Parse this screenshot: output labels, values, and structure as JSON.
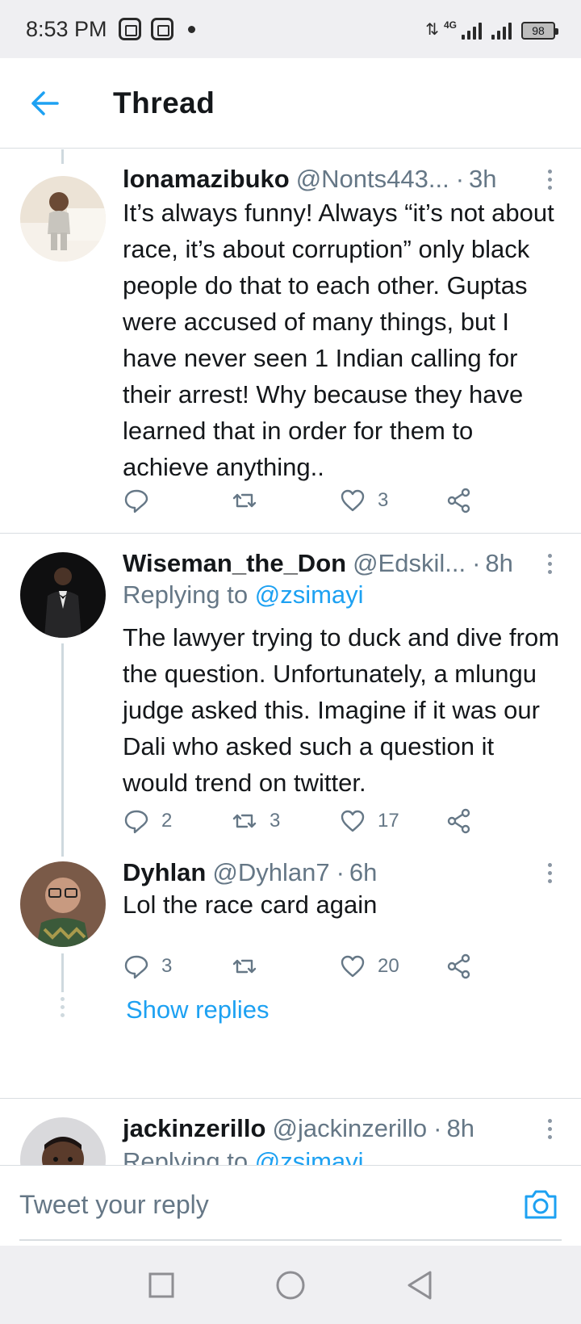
{
  "status_bar": {
    "time": "8:53 PM",
    "network": "4G",
    "battery": "98"
  },
  "header": {
    "title": "Thread",
    "back_icon": "arrow-left-icon"
  },
  "tweets": [
    {
      "name": "lonamazibuko",
      "handle": "@Nonts443...",
      "sep": "·",
      "time": "3h",
      "reply_to_prefix": "",
      "reply_to": "",
      "text": "It’s always funny! Always “it’s not about race, it’s about corruption” only black people do that to each other. Guptas were accused of many things, but I have never seen 1 Indian calling for their arrest! Why because they have learned that in order for them to achieve anything..",
      "replies": "",
      "retweets": "",
      "likes": "3"
    },
    {
      "name": "Wiseman_the_Don",
      "handle": "@Edskil...",
      "sep": "·",
      "time": "8h",
      "reply_to_prefix": "Replying to",
      "reply_to": "@zsimayi",
      "text": "The lawyer trying to duck and dive from the question. Unfortunately, a mlungu judge asked this. Imagine if it was our Dali who asked such a question it would trend on twitter.",
      "replies": "2",
      "retweets": "3",
      "likes": "17"
    },
    {
      "name": "Dyhlan",
      "handle": "@Dyhlan7",
      "sep": "·",
      "time": "6h",
      "reply_to_prefix": "",
      "reply_to": "",
      "text": "Lol the race card again",
      "replies": "3",
      "retweets": "",
      "likes": "20"
    },
    {
      "name": "jackinzerillo",
      "handle": "@jackinzerillo",
      "sep": "·",
      "time": "8h",
      "reply_to_prefix": "Replying to",
      "reply_to": "@zsimayi",
      "text": "",
      "replies": "",
      "retweets": "",
      "likes": ""
    }
  ],
  "show_replies_label": "Show replies",
  "composer": {
    "placeholder": "Tweet your reply",
    "camera_icon": "camera-icon"
  },
  "nav": {
    "recents_icon": "square-icon",
    "home_icon": "circle-icon",
    "back_icon": "triangle-back-icon"
  },
  "colors": {
    "accent": "#1da1f2",
    "secondary_text": "#657786",
    "divider": "#d9dde1"
  }
}
